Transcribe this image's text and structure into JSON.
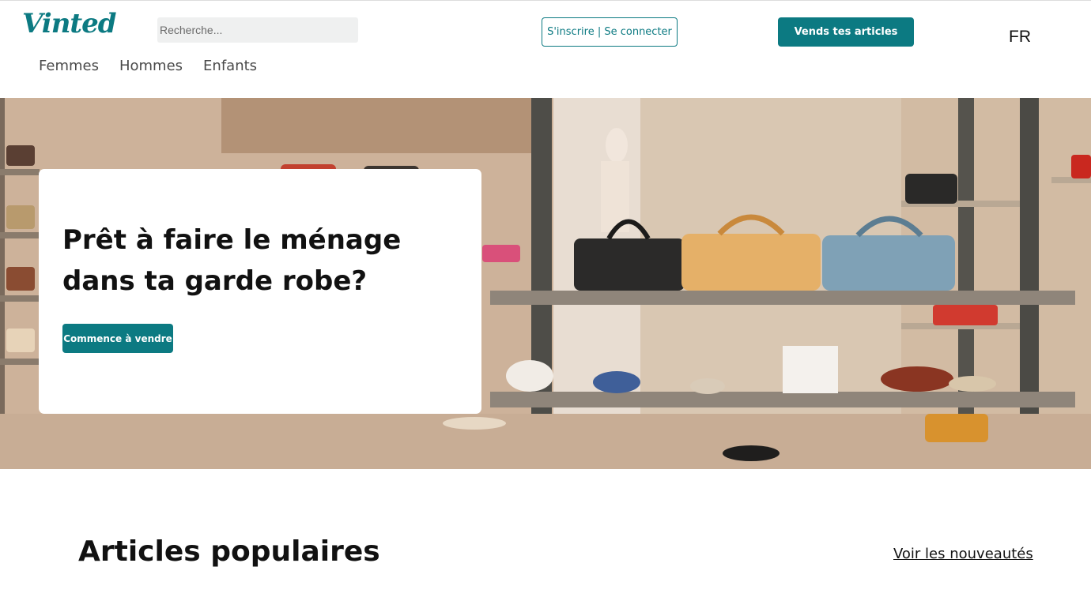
{
  "header": {
    "logo_text": "Vinted",
    "search_placeholder": "Recherche...",
    "login_label": "S'inscrire | Se connecter",
    "sell_label": "Vends tes articles",
    "language": "FR"
  },
  "nav": {
    "items": [
      {
        "label": "Femmes"
      },
      {
        "label": "Hommes"
      },
      {
        "label": "Enfants"
      }
    ]
  },
  "hero": {
    "title": "Prêt à faire le ménage dans ta garde robe?",
    "cta_label": "Commence à vendre"
  },
  "section": {
    "title": "Articles populaires",
    "link_label": "Voir les nouveautés"
  },
  "colors": {
    "brand": "#0c7a82",
    "search_bg": "#eff0f0"
  }
}
